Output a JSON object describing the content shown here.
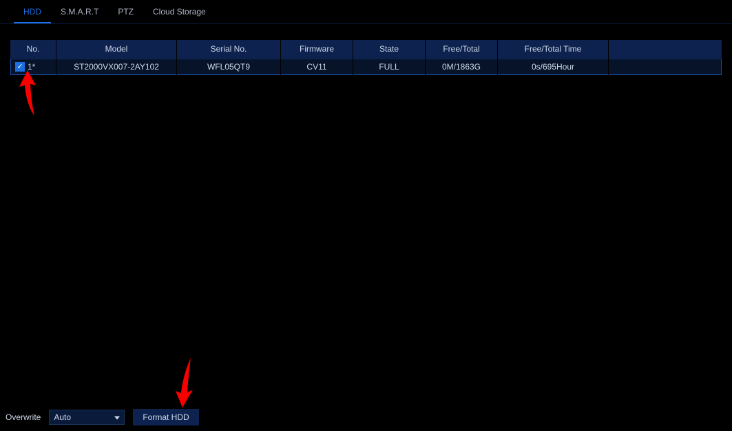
{
  "tabs": [
    {
      "label": "HDD",
      "active": true
    },
    {
      "label": "S.M.A.R.T",
      "active": false
    },
    {
      "label": "PTZ",
      "active": false
    },
    {
      "label": "Cloud Storage",
      "active": false
    }
  ],
  "table": {
    "headers": {
      "no": "No.",
      "model": "Model",
      "serial": "Serial No.",
      "firmware": "Firmware",
      "state": "State",
      "free_total": "Free/Total",
      "free_total_time": "Free/Total Time"
    },
    "rows": [
      {
        "checked": true,
        "no": "1*",
        "model": "ST2000VX007-2AY102",
        "serial": "WFL05QT9",
        "firmware": "CV11",
        "state": "FULL",
        "free_total": "0M/1863G",
        "free_total_time": "0s/695Hour"
      }
    ]
  },
  "footer": {
    "overwrite_label": "Overwrite",
    "overwrite_value": "Auto",
    "format_button": "Format HDD"
  }
}
